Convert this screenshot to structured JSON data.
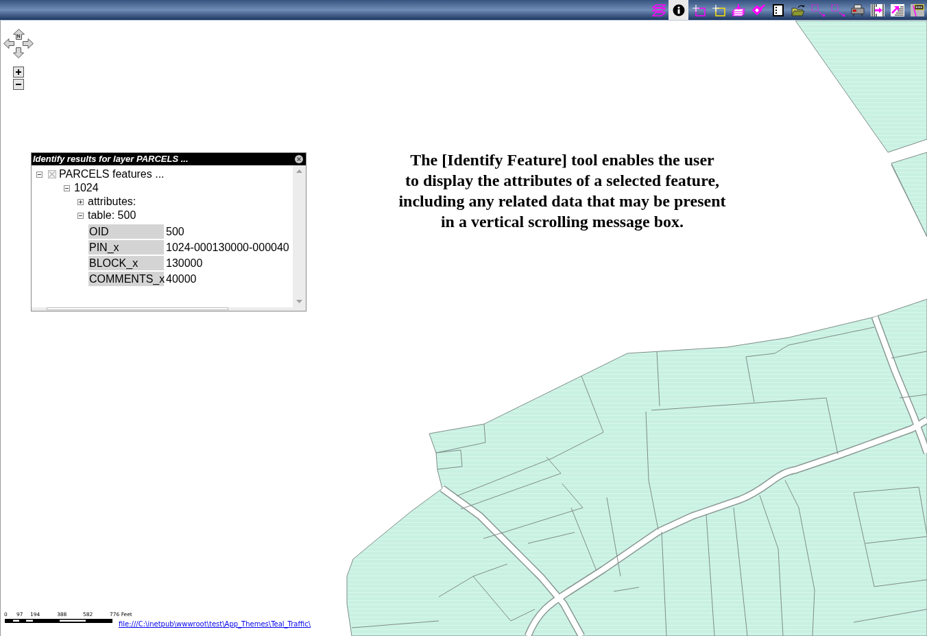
{
  "toolbar": {
    "tools": [
      {
        "kind": "layers",
        "selected": false
      },
      {
        "kind": "info",
        "selected": true
      },
      {
        "kind": "box_magenta",
        "selected": false
      },
      {
        "kind": "box_yellow",
        "selected": false
      },
      {
        "kind": "stack_arrow",
        "selected": false
      },
      {
        "kind": "tag_arrow",
        "selected": false
      },
      {
        "kind": "list_page",
        "selected": false
      },
      {
        "kind": "folder",
        "selected": false
      },
      {
        "kind": "dotted_line",
        "selected": false
      },
      {
        "kind": "dotted_line",
        "selected": false
      },
      {
        "kind": "printer",
        "selected": false
      },
      {
        "kind": "ruler_arrow",
        "selected": false
      },
      {
        "kind": "diagonal_arrow",
        "selected": false
      },
      {
        "kind": "sign",
        "selected": false
      }
    ]
  },
  "nav": {
    "north_label": "N"
  },
  "identify_panel": {
    "title": "Identify results for layer PARCELS ...",
    "tree": [
      {
        "kind": "layer",
        "label": "PARCELS features ...",
        "expanded": true,
        "children": [
          {
            "kind": "item",
            "label": "1024",
            "expanded": true,
            "children": [
              {
                "kind": "item",
                "label": "attributes:",
                "expanded": false
              },
              {
                "kind": "item",
                "label": "table: 500",
                "expanded": true,
                "rows": [
                  {
                    "field": "OID",
                    "value": "500"
                  },
                  {
                    "field": "PIN_x",
                    "value": "1024-000130000-000040"
                  },
                  {
                    "field": "BLOCK_x",
                    "value": "130000"
                  },
                  {
                    "field": "COMMENTS_x",
                    "value": "40000"
                  }
                ]
              }
            ]
          }
        ]
      }
    ]
  },
  "caption": {
    "lines": [
      "The [Identify Feature] tool enables the user",
      "to display the attributes of a selected feature,",
      "including any related data that may be present",
      "in a vertical scrolling message box."
    ]
  },
  "scale_bar": {
    "labels": [
      "0",
      "97",
      "194",
      "388",
      "582",
      "776 Feet"
    ]
  },
  "file_link": "file:///C:\\inetpub\\wwwroot\\test\\App_Themes\\Teal_Traffic\\"
}
